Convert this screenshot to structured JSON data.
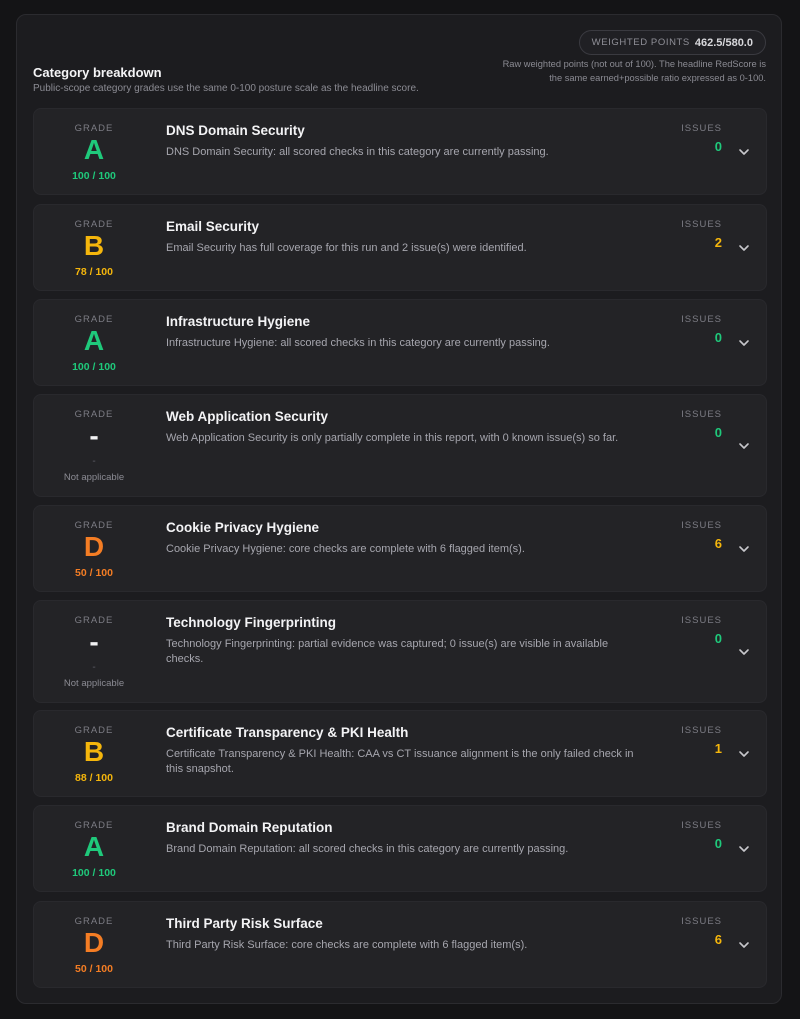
{
  "header": {
    "title": "Category breakdown",
    "subtitle": "Public-scope category grades use the same 0-100 posture scale as the headline score.",
    "weighted_points_label": "WEIGHTED POINTS",
    "weighted_points_value": "462.5/580.0",
    "note": "Raw weighted points (not out of 100). The headline RedScore is the same earned+possible ratio expressed as 0-100."
  },
  "labels": {
    "grade": "GRADE",
    "issues": "ISSUES"
  },
  "colors": {
    "green": "#1fc97b",
    "yellow": "#f5b60c",
    "orange": "#f47d24"
  },
  "categories": [
    {
      "name": "DNS Domain Security",
      "grade": "A",
      "score": "100 / 100",
      "desc": "DNS Domain Security: all scored checks in this category are currently passing.",
      "issues": "0"
    },
    {
      "name": "Email Security",
      "grade": "B",
      "score": "78 / 100",
      "desc": "Email Security has full coverage for this run and 2 issue(s) were identified.",
      "issues": "2"
    },
    {
      "name": "Infrastructure Hygiene",
      "grade": "A",
      "score": "100 / 100",
      "desc": "Infrastructure Hygiene: all scored checks in this category are currently passing.",
      "issues": "0"
    },
    {
      "name": "Web Application Security",
      "grade": "-",
      "score": "-",
      "na": "Not applicable",
      "desc": "Web Application Security is only partially complete in this report, with 0 known issue(s) so far.",
      "issues": "0"
    },
    {
      "name": "Cookie Privacy Hygiene",
      "grade": "D",
      "score": "50 / 100",
      "desc": "Cookie Privacy Hygiene: core checks are complete with 6 flagged item(s).",
      "issues": "6"
    },
    {
      "name": "Technology Fingerprinting",
      "grade": "-",
      "score": "-",
      "na": "Not applicable",
      "desc": "Technology Fingerprinting: partial evidence was captured; 0 issue(s) are visible in available checks.",
      "issues": "0"
    },
    {
      "name": "Certificate Transparency & PKI Health",
      "grade": "B",
      "score": "88 / 100",
      "desc": "Certificate Transparency & PKI Health: CAA vs CT issuance alignment is the only failed check in this snapshot.",
      "issues": "1"
    },
    {
      "name": "Brand Domain Reputation",
      "grade": "A",
      "score": "100 / 100",
      "desc": "Brand Domain Reputation: all scored checks in this category are currently passing.",
      "issues": "0"
    },
    {
      "name": "Third Party Risk Surface",
      "grade": "D",
      "score": "50 / 100",
      "desc": "Third Party Risk Surface: core checks are complete with 6 flagged item(s).",
      "issues": "6"
    }
  ]
}
